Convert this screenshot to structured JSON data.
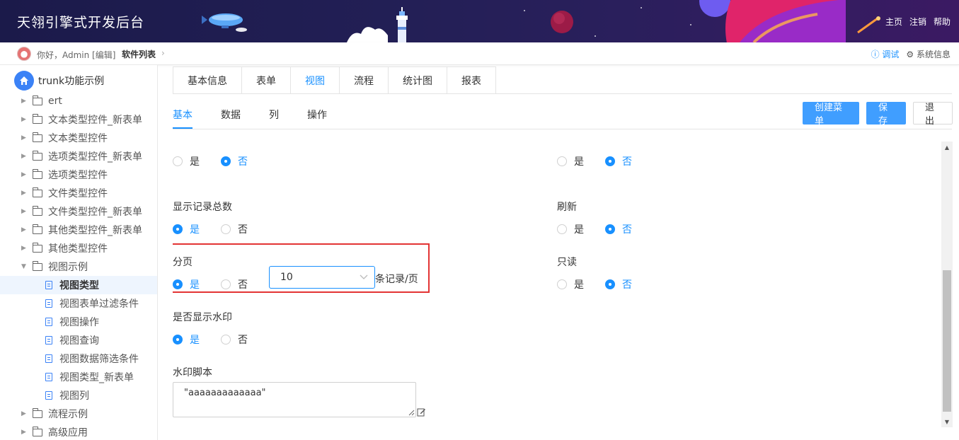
{
  "header": {
    "app_title": "天翎引擎式开发后台",
    "nav": [
      "主页",
      "注销",
      "帮助"
    ]
  },
  "subbar": {
    "greeting": "你好，Admin [编辑]",
    "breadcrumb": "软件列表",
    "debug_label": "调试",
    "sysinfo_label": "系统信息"
  },
  "sidebar": {
    "root_label": "trunk功能示例",
    "items": [
      {
        "label": "ert",
        "type": "folder",
        "state": "collapsed"
      },
      {
        "label": "文本类型控件_新表单",
        "type": "folder",
        "state": "collapsed"
      },
      {
        "label": "文本类型控件",
        "type": "folder",
        "state": "collapsed"
      },
      {
        "label": "选项类型控件_新表单",
        "type": "folder",
        "state": "collapsed"
      },
      {
        "label": "选项类型控件",
        "type": "folder",
        "state": "collapsed"
      },
      {
        "label": "文件类型控件",
        "type": "folder",
        "state": "collapsed"
      },
      {
        "label": "文件类型控件_新表单",
        "type": "folder",
        "state": "collapsed"
      },
      {
        "label": "其他类型控件_新表单",
        "type": "folder",
        "state": "collapsed"
      },
      {
        "label": "其他类型控件",
        "type": "folder",
        "state": "collapsed"
      },
      {
        "label": "视图示例",
        "type": "folder",
        "state": "expanded"
      },
      {
        "label": "视图类型",
        "type": "doc",
        "state": "active"
      },
      {
        "label": "视图表单过滤条件",
        "type": "doc",
        "state": ""
      },
      {
        "label": "视图操作",
        "type": "doc",
        "state": ""
      },
      {
        "label": "视图查询",
        "type": "doc",
        "state": ""
      },
      {
        "label": "视图数据筛选条件",
        "type": "doc",
        "state": ""
      },
      {
        "label": "视图类型_新表单",
        "type": "doc",
        "state": ""
      },
      {
        "label": "视图列",
        "type": "doc",
        "state": ""
      },
      {
        "label": "流程示例",
        "type": "folder",
        "state": "collapsed"
      },
      {
        "label": "高级应用",
        "type": "folder",
        "state": "collapsed"
      }
    ]
  },
  "top_tabs": [
    "基本信息",
    "表单",
    "视图",
    "流程",
    "统计图",
    "报表"
  ],
  "top_tabs_active": 2,
  "sub_tabs": [
    "基本",
    "数据",
    "列",
    "操作"
  ],
  "sub_tabs_active": 0,
  "buttons": {
    "create_menu": "创建菜单",
    "save": "保存",
    "exit": "退出"
  },
  "form": {
    "yes": "是",
    "no": "否",
    "show_total_label": "显示记录总数",
    "show_total_value": "是",
    "refresh_label": "刷新",
    "refresh_value": "否",
    "paging_label": "分页",
    "paging_value": "是",
    "page_size": "10",
    "page_unit": "条记录/页",
    "readonly_label": "只读",
    "readonly_value": "否",
    "watermark_label": "是否显示水印",
    "watermark_value": "是",
    "watermark_script_label": "水印脚本",
    "watermark_script_value": "\"aaaaaaaaaaaaa\"",
    "top_left_value": "否",
    "top_right_value": "否"
  },
  "colors": {
    "accent": "#1890ff",
    "highlight": "#e33434",
    "header_bg": "#1b1a4a"
  }
}
